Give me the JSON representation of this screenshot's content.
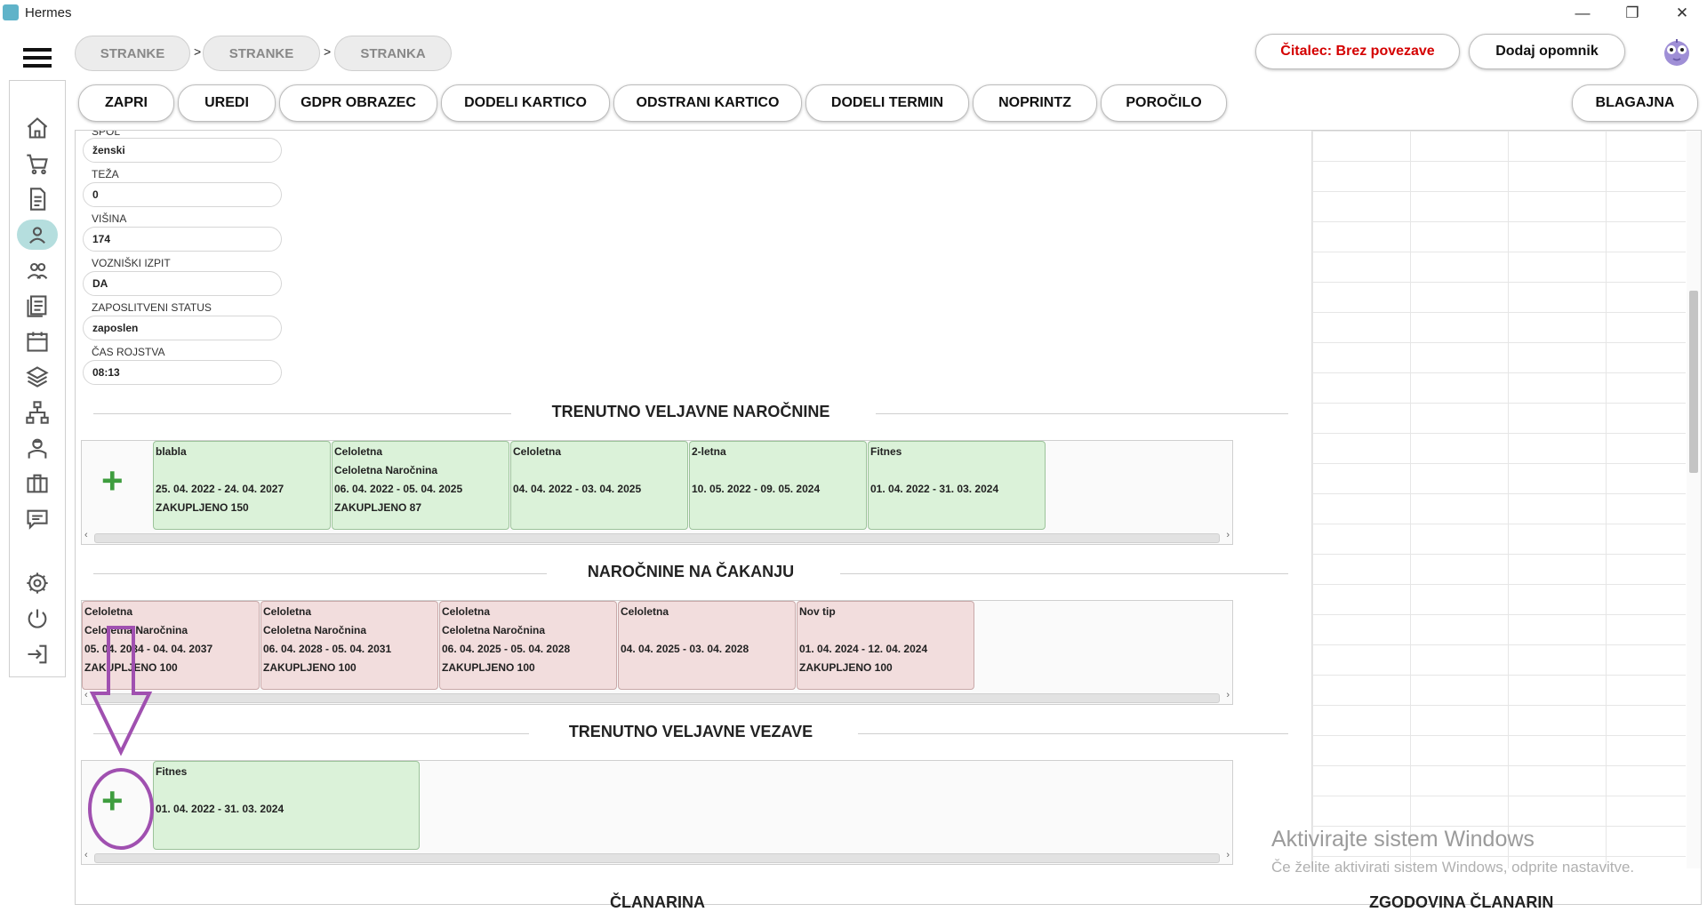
{
  "window": {
    "title": "Hermes",
    "minimize": "—",
    "maximize": "❐",
    "close": "✕"
  },
  "breadcrumb": {
    "items": [
      "STRANKE",
      "STRANKE",
      "STRANKA"
    ],
    "separator": ">"
  },
  "header": {
    "reader_status": "Čitalec: Brez povezave",
    "reminder_button": "Dodaj opomnik",
    "reader_status_color": "#d40000"
  },
  "toolbar": {
    "buttons": [
      "ZAPRI",
      "UREDI",
      "GDPR OBRAZEC",
      "DODELI KARTICO",
      "ODSTRANI KARTICO",
      "DODELI TERMIN",
      "NOPRINTZ",
      "POROČILO"
    ],
    "right_button": "BLAGAJNA"
  },
  "sidebar": {
    "icons": [
      "home-icon",
      "cart-icon",
      "document-icon",
      "person-icon",
      "people-icon",
      "list-icon",
      "calendar-icon",
      "layers-icon",
      "network-icon",
      "trainer-icon",
      "briefcase-icon",
      "chat-icon",
      "gear-icon",
      "power-icon",
      "logout-icon"
    ],
    "active": "person-icon"
  },
  "form": {
    "gender_value": "ženski",
    "fields": [
      {
        "label": "TEŽA",
        "value": "0"
      },
      {
        "label": "VIŠINA",
        "value": "174"
      },
      {
        "label": "VOZNIŠKI IZPIT",
        "value": "DA"
      },
      {
        "label": "ZAPOSLITVENI STATUS",
        "value": "zaposlen"
      },
      {
        "label": "ČAS ROJSTVA",
        "value": "08:13"
      }
    ]
  },
  "sections": {
    "active_subscriptions": {
      "title": "TRENUTNO VELJAVNE NAROČNINE",
      "add_icon": "plus-icon",
      "cards": [
        {
          "line1": "blabla",
          "line2": "",
          "line3": "25. 04. 2022 - 24. 04. 2027",
          "line4": "ZAKUPLJENO 150"
        },
        {
          "line1": "Celoletna",
          "line2": "Celoletna Naročnina",
          "line3": "06. 04. 2022 - 05. 04. 2025",
          "line4": "ZAKUPLJENO 87"
        },
        {
          "line1": "Celoletna",
          "line2": "",
          "line3": "04. 04. 2022 - 03. 04. 2025",
          "line4": ""
        },
        {
          "line1": "2-letna",
          "line2": "",
          "line3": "10. 05. 2022 - 09. 05. 2024",
          "line4": ""
        },
        {
          "line1": "Fitnes",
          "line2": "",
          "line3": "01. 04. 2022 - 31. 03. 2024",
          "line4": ""
        }
      ]
    },
    "pending_subscriptions": {
      "title": "NAROČNINE NA ČAKANJU",
      "cards": [
        {
          "line1": "Celoletna",
          "line2": "Celoletna Naročnina",
          "line3": "05. 04. 2034 - 04. 04. 2037",
          "line4": "ZAKUPLJENO 100"
        },
        {
          "line1": "Celoletna",
          "line2": "Celoletna Naročnina",
          "line3": "06. 04. 2028 - 05. 04. 2031",
          "line4": "ZAKUPLJENO 100"
        },
        {
          "line1": "Celoletna",
          "line2": "Celoletna Naročnina",
          "line3": "06. 04. 2025 - 05. 04. 2028",
          "line4": "ZAKUPLJENO 100"
        },
        {
          "line1": "Celoletna",
          "line2": "",
          "line3": "04. 04. 2025 - 03. 04. 2028",
          "line4": ""
        },
        {
          "line1": "Nov tip",
          "line2": "",
          "line3": "01. 04. 2024 - 12. 04. 2024",
          "line4": "ZAKUPLJENO 100"
        }
      ]
    },
    "active_bindings": {
      "title": "TRENUTNO VELJAVNE VEZAVE",
      "add_icon": "plus-icon",
      "cards": [
        {
          "line1": "Fitnes",
          "line2": "",
          "line3": "01. 04. 2022 - 31. 03. 2024",
          "line4": ""
        }
      ]
    }
  },
  "bottom": {
    "left_heading": "ČLANARINA",
    "right_heading": "ZGODOVINA ČLANARIN"
  },
  "watermark": {
    "line1": "Aktivirajte sistem Windows",
    "line2": "Če želite aktivirati sistem Windows, odprite nastavitve."
  },
  "annotation": {
    "color": "#a050b0"
  }
}
